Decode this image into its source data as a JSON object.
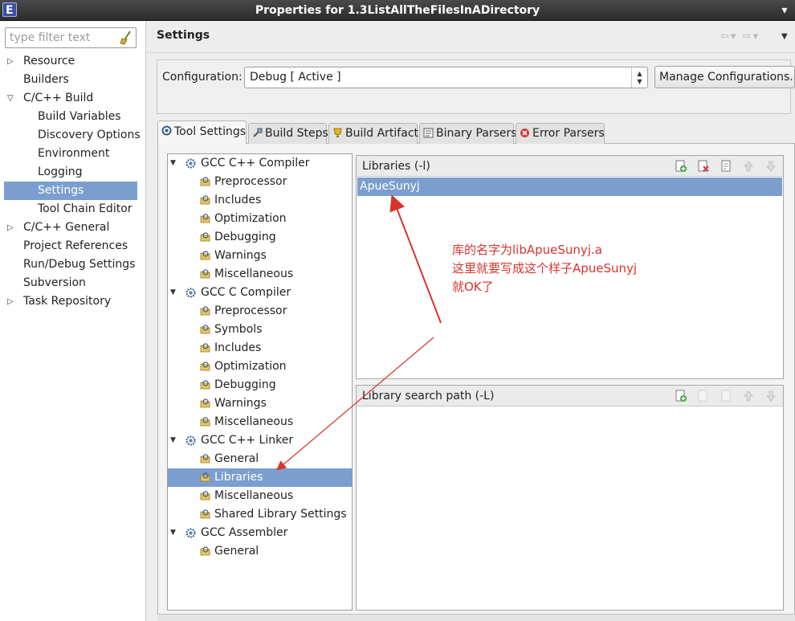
{
  "window": {
    "title": "Properties for 1.3ListAllTheFilesInADirectory"
  },
  "filter": {
    "placeholder": "type filter text"
  },
  "sidebar": {
    "items": [
      {
        "label": "Resource",
        "expandable": true,
        "level": 0
      },
      {
        "label": "Builders",
        "level": 0
      },
      {
        "label": "C/C++ Build",
        "expanded": true,
        "level": 0
      },
      {
        "label": "Build Variables",
        "level": 1
      },
      {
        "label": "Discovery Options",
        "level": 1
      },
      {
        "label": "Environment",
        "level": 1
      },
      {
        "label": "Logging",
        "level": 1
      },
      {
        "label": "Settings",
        "level": 1,
        "selected": true
      },
      {
        "label": "Tool Chain Editor",
        "level": 1
      },
      {
        "label": "C/C++ General",
        "expandable": true,
        "level": 0
      },
      {
        "label": "Project References",
        "level": 0
      },
      {
        "label": "Run/Debug Settings",
        "level": 0
      },
      {
        "label": "Subversion",
        "level": 0
      },
      {
        "label": "Task Repository",
        "expandable": true,
        "level": 0
      }
    ]
  },
  "header": {
    "title": "Settings"
  },
  "config": {
    "label": "Configuration:",
    "value": "Debug  [ Active ]",
    "manage_label": "Manage Configurations..."
  },
  "tabs": [
    {
      "label": "Tool Settings",
      "active": true
    },
    {
      "label": "Build Steps"
    },
    {
      "label": "Build Artifact"
    },
    {
      "label": "Binary Parsers"
    },
    {
      "label": "Error Parsers"
    }
  ],
  "tool_tree": [
    {
      "label": "GCC C++ Compiler",
      "type": "category"
    },
    {
      "label": "Preprocessor",
      "type": "option"
    },
    {
      "label": "Includes",
      "type": "option"
    },
    {
      "label": "Optimization",
      "type": "option"
    },
    {
      "label": "Debugging",
      "type": "option"
    },
    {
      "label": "Warnings",
      "type": "option"
    },
    {
      "label": "Miscellaneous",
      "type": "option"
    },
    {
      "label": "GCC C Compiler",
      "type": "category"
    },
    {
      "label": "Preprocessor",
      "type": "option"
    },
    {
      "label": "Symbols",
      "type": "option"
    },
    {
      "label": "Includes",
      "type": "option"
    },
    {
      "label": "Optimization",
      "type": "option"
    },
    {
      "label": "Debugging",
      "type": "option"
    },
    {
      "label": "Warnings",
      "type": "option"
    },
    {
      "label": "Miscellaneous",
      "type": "option"
    },
    {
      "label": "GCC C++ Linker",
      "type": "category"
    },
    {
      "label": "General",
      "type": "option"
    },
    {
      "label": "Libraries",
      "type": "option",
      "selected": true
    },
    {
      "label": "Miscellaneous",
      "type": "option"
    },
    {
      "label": "Shared Library Settings",
      "type": "option"
    },
    {
      "label": "GCC Assembler",
      "type": "category"
    },
    {
      "label": "General",
      "type": "option"
    }
  ],
  "libraries": {
    "title": "Libraries (-l)",
    "items": [
      "ApueSunyj"
    ]
  },
  "library_paths": {
    "title": "Library search path (-L)",
    "items": []
  },
  "annotation": {
    "lines": [
      "库的名字为libApueSunyj.a",
      "这里就要写成这个样子ApueSunyj",
      "就OK了"
    ],
    "color": "#d9332c"
  },
  "colors": {
    "selection": "#7b9ecf",
    "titlebar": "#3a3a3a"
  }
}
